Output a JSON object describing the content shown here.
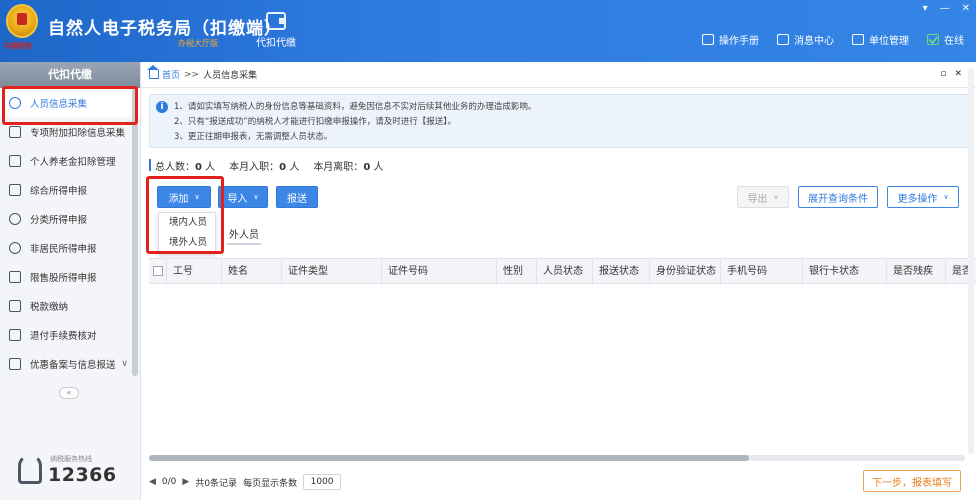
{
  "header": {
    "app_title": "自然人电子税务局（扣缴端）",
    "edition": "办税大厅版",
    "logo_sub": "中国税务",
    "module_label": "代扣代缴",
    "window_controls": [
      "▾",
      "—",
      "✕"
    ],
    "actions": [
      {
        "label": "操作手册",
        "icon": "manual-icon"
      },
      {
        "label": "消息中心",
        "icon": "mail-icon"
      },
      {
        "label": "单位管理",
        "icon": "org-icon"
      },
      {
        "label": "在线",
        "icon": "online-check-icon",
        "color": "#6fd37c"
      }
    ]
  },
  "sidebar": {
    "title": "代扣代缴",
    "items": [
      {
        "label": "人员信息采集",
        "icon": "person-icon",
        "active": true
      },
      {
        "label": "专项附加扣除信息采集",
        "icon": "list-icon"
      },
      {
        "label": "个人养老金扣除管理",
        "icon": "document-icon"
      },
      {
        "label": "综合所得申报",
        "icon": "layers-icon"
      },
      {
        "label": "分类所得申报",
        "icon": "pie-icon"
      },
      {
        "label": "非居民所得申报",
        "icon": "user-icon"
      },
      {
        "label": "限售股所得申报",
        "icon": "bar-icon"
      },
      {
        "label": "税款缴纳",
        "icon": "folder-icon"
      },
      {
        "label": "退付手续费核对",
        "icon": "checklist-icon"
      },
      {
        "label": "优惠备案与信息报送",
        "icon": "record-icon",
        "chevron": "∨"
      }
    ],
    "collapse_label": "«",
    "hotline_label": "纳税服务热线",
    "hotline_number": "12366"
  },
  "breadcrumb": {
    "home": "首页",
    "separator": ">>",
    "current": "人员信息采集"
  },
  "panel_controls": [
    "▫",
    "✕"
  ],
  "notice": {
    "lines": [
      "1、请如实填写纳税人的身份信息等基础资料，避免因信息不实对后续其他业务的办理造成影响。",
      "2、只有“报送成功”的纳税人才能进行扣缴申报操作，请及时进行【报送】。",
      "3、更正往期申报表，无需调整人员状态。"
    ]
  },
  "stats": {
    "total_label": "总人数：",
    "total_value": "0",
    "joined_label": "本月入职：",
    "joined_value": "0",
    "left_label": "本月离职：",
    "left_value": "0",
    "unit": "人"
  },
  "toolbar": {
    "add": "添加",
    "import": "导入",
    "submit": "报送",
    "export": "导出",
    "expand_query": "展开查询条件",
    "more": "更多操作",
    "caret": "∨"
  },
  "add_menu": {
    "items": [
      "境内人员",
      "境外人员"
    ]
  },
  "subtab_visible": "外人员",
  "table": {
    "columns": [
      "工号",
      "姓名",
      "证件类型",
      "证件号码",
      "性别",
      "人员状态",
      "报送状态",
      "身份验证状态",
      "手机号码",
      "银行卡状态",
      "是否残疾",
      "是否"
    ]
  },
  "pager": {
    "prev": "◀",
    "page": "0/0",
    "next": "▶",
    "total_text": "共0条记录",
    "per_page_label": "每页显示条数",
    "per_page_value": "1000"
  },
  "next_step": "下一步，报表填写",
  "colors": {
    "brand_blue": "#2f7be0",
    "highlight_red": "#e0211c",
    "next_orange": "#e97d1c"
  }
}
